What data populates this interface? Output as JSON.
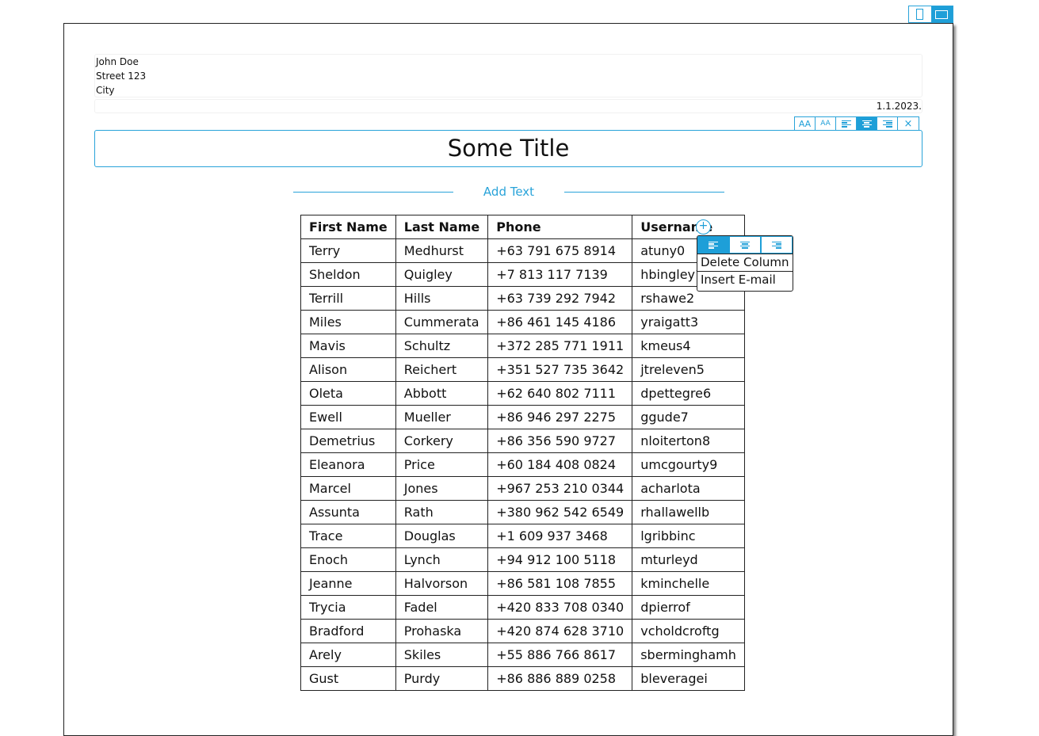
{
  "orientation": {
    "selected": "landscape"
  },
  "sender": {
    "name": "John Doe",
    "street": "Street 123",
    "city": "City"
  },
  "date": "1.1.2023.",
  "title_toolbar": {
    "font_larger_label": "AA",
    "font_smaller_label": "AA",
    "close_label": "×",
    "selected_alignment": "center"
  },
  "title": "Some Title",
  "add_text_label": "Add Text",
  "table": {
    "headers": [
      "First Name",
      "Last Name",
      "Phone",
      "Username"
    ],
    "rows": [
      [
        "Terry",
        "Medhurst",
        "+63 791 675 8914",
        "atuny0"
      ],
      [
        "Sheldon",
        "Quigley",
        "+7 813 117 7139",
        "hbingley1"
      ],
      [
        "Terrill",
        "Hills",
        "+63 739 292 7942",
        "rshawe2"
      ],
      [
        "Miles",
        "Cummerata",
        "+86 461 145 4186",
        "yraigatt3"
      ],
      [
        "Mavis",
        "Schultz",
        "+372 285 771 1911",
        "kmeus4"
      ],
      [
        "Alison",
        "Reichert",
        "+351 527 735 3642",
        "jtreleven5"
      ],
      [
        "Oleta",
        "Abbott",
        "+62 640 802 7111",
        "dpettegre6"
      ],
      [
        "Ewell",
        "Mueller",
        "+86 946 297 2275",
        "ggude7"
      ],
      [
        "Demetrius",
        "Corkery",
        "+86 356 590 9727",
        "nloiterton8"
      ],
      [
        "Eleanora",
        "Price",
        "+60 184 408 0824",
        "umcgourty9"
      ],
      [
        "Marcel",
        "Jones",
        "+967 253 210 0344",
        "acharlota"
      ],
      [
        "Assunta",
        "Rath",
        "+380 962 542 6549",
        "rhallawellb"
      ],
      [
        "Trace",
        "Douglas",
        "+1 609 937 3468",
        "lgribbinc"
      ],
      [
        "Enoch",
        "Lynch",
        "+94 912 100 5118",
        "mturleyd"
      ],
      [
        "Jeanne",
        "Halvorson",
        "+86 581 108 7855",
        "kminchelle"
      ],
      [
        "Trycia",
        "Fadel",
        "+420 833 708 0340",
        "dpierrof"
      ],
      [
        "Bradford",
        "Prohaska",
        "+420 874 628 3710",
        "vcholdcroftg"
      ],
      [
        "Arely",
        "Skiles",
        "+55 886 766 8617",
        "sberminghamh"
      ],
      [
        "Gust",
        "Purdy",
        "+86 886 889 0258",
        "bleveragei"
      ]
    ]
  },
  "column_menu": {
    "add_column_label": "+",
    "selected_alignment": "left",
    "delete_label": "Delete Column",
    "insert_label": "Insert E-mail"
  },
  "colors": {
    "accent": "#1e9fd8",
    "border": "#222222"
  }
}
